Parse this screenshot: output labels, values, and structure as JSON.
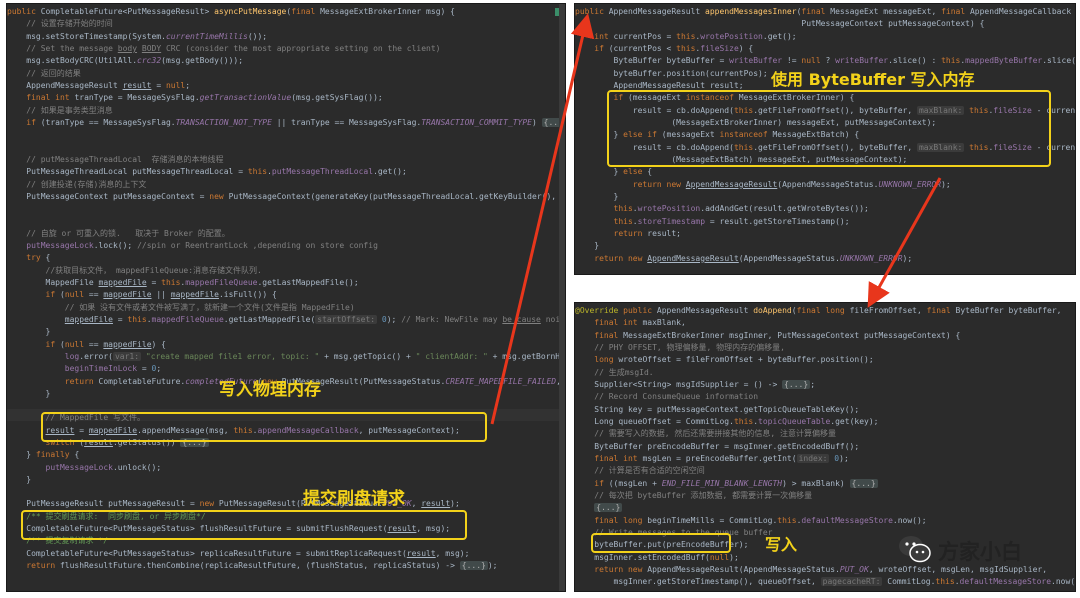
{
  "colors": {
    "highlight_box": "#f3d21a",
    "arrow": "#e8361c",
    "editor_bg": "#2b2b2b"
  },
  "left_panel": {
    "lines": [
      "public CompletableFuture<PutMessageResult> asyncPutMessage(final MessageExtBrokerInner msg) {",
      "    // 设置存储开始的时间",
      "    msg.setStoreTimestamp(System.currentTimeMillis());",
      "    // Set the message body BODY CRC (consider the most appropriate setting on the client)",
      "    msg.setBodyCRC(UtilAll.crc32(msg.getBody()));",
      "    // 返回的结果",
      "    AppendMessageResult result = null;",
      "    final int tranType = MessageSysFlag.getTransactionValue(msg.getSysFlag());",
      "    // 如果是事务类型消息",
      "    if (tranType == MessageSysFlag.TRANSACTION_NOT_TYPE || tranType == MessageSysFlag.TRANSACTION_COMMIT_TYPE) {...}",
      "",
      "    // putMessageThreadLocal  存储消息的本地线程",
      "    PutMessageThreadLocal putMessageThreadLocal = this.putMessageThreadLocal.get();",
      "    // 创建投递(存储)消息的上下文",
      "    PutMessageContext putMessageContext = new PutMessageContext(generateKey(putMessageThreadLocal.getKeyBuilder(), m",
      "",
      "    // 自旋 or 可重入的锁.   取决于 Broker 的配置。",
      "    putMessageLock.lock(); //spin or ReentrantLock ,depending on store config",
      "    try {",
      "        //获取目标文件， mappedFileQueue:消息存储文件队列.",
      "        MappedFile mappedFile = this.mappedFileQueue.getLastMappedFile();",
      "        if (null == mappedFile || mappedFile.isFull()) {",
      "            // 如果 没有文件或者文件被写满了，就新建一个文件(文件是指 MappedFile)",
      "            mappedFile = this.mappedFileQueue.getLastMappedFile( startOffset: 0); // Mark: NewFile may be cause noise",
      "        }",
      "        if (null == mappedFile) {",
      "            log.error( var1: \"create mapped file1 error, topic: \" + msg.getTopic() + \" clientAddr: \" + msg.getBornHost",
      "            beginTimeInLock = 0;",
      "            return CompletableFuture.completedFuture(new PutMessageResult(PutMessageStatus.CREATE_MAPEDFILE_FAILED,",
      "        }",
      "        // MappedFile 写文件。",
      "        result = mappedFile.appendMessage(msg, this.appendMessageCallback, putMessageContext);",
      "        switch (result.getStatus()) {...}",
      "    } finally {",
      "        putMessageLock.unlock();",
      "    }",
      "",
      "    PutMessageResult putMessageResult = new PutMessageResult(PutMessageStatus.PUT_OK, result);",
      "    /** 提交刷盘请求:  同步刷盘, or 异步刷盘*/",
      "    CompletableFuture<PutMessageStatus> flushResultFuture = submitFlushRequest(result, msg);",
      "    /** 提交复制请求 */",
      "    CompletableFuture<PutMessageStatus> replicaResultFuture = submitReplicaRequest(result, msg);",
      "    return flushResultFuture.thenCombine(replicaResultFuture, (flushStatus, replicaStatus) -> {...});"
    ],
    "label_write": "写入物理内存",
    "label_flush": "提交刷盘请求"
  },
  "top_right_panel": {
    "lines": [
      "public AppendMessageResult appendMessagesInner(final MessageExt messageExt, final AppendMessageCallback cb,",
      "                                               PutMessageContext putMessageContext) {",
      "    int currentPos = this.wrotePosition.get();",
      "    if (currentPos < this.fileSize) {",
      "        ByteBuffer byteBuffer = writeBuffer != null ? writeBuffer.slice() : this.mappedByteBuffer.slice();",
      "        byteBuffer.position(currentPos);",
      "        AppendMessageResult result;",
      "        if (messageExt instanceof MessageExtBrokerInner) {",
      "            result = cb.doAppend(this.getFileFromOffset(), byteBuffer,  maxBlank: this.fileSize - currentPos,",
      "                    (MessageExtBrokerInner) messageExt, putMessageContext);",
      "        } else if (messageExt instanceof MessageExtBatch) {",
      "            result = cb.doAppend(this.getFileFromOffset(), byteBuffer,  maxBlank: this.fileSize - currentPos,",
      "                    (MessageExtBatch) messageExt, putMessageContext);",
      "        } else {",
      "            return new AppendMessageResult(AppendMessageStatus.UNKNOWN_ERROR);",
      "        }",
      "        this.wrotePosition.addAndGet(result.getWroteBytes());",
      "        this.storeTimestamp = result.getStoreTimestamp();",
      "        return result;",
      "    }",
      "    return new AppendMessageResult(AppendMessageStatus.UNKNOWN_ERROR);"
    ],
    "label_bytebuffer": "使用 ByteBuffer 写入内存"
  },
  "bottom_right_panel": {
    "lines": [
      "@Override public AppendMessageResult doAppend(final long fileFromOffset, final ByteBuffer byteBuffer,",
      "    final int maxBlank,",
      "    final MessageExtBrokerInner msgInner, PutMessageContext putMessageContext) {",
      "    // PHY OFFSET, 物理偏移量, 物理内存的偏移量,",
      "    long wroteOffset = fileFromOffset + byteBuffer.position();",
      "    // 生成msgId.",
      "    Supplier<String> msgIdSupplier = () -> {...};",
      "    // Record ConsumeQueue information",
      "    String key = putMessageContext.getTopicQueueTableKey();",
      "    Long queueOffset = CommitLog.this.topicQueueTable.get(key);",
      "    // 需要写入的数据, 然后还需要拼接其他的信息, 注意计算偏移量",
      "    ByteBuffer preEncodeBuffer = msgInner.getEncodedBuff();",
      "    final int msgLen = preEncodeBuffer.getInt( index: 0);",
      "    // 计算是否有合适的空闲空间",
      "    if ((msgLen + END_FILE_MIN_BLANK_LENGTH) > maxBlank) {...}",
      "    // 每次把 byteBuffer 添加数据, 都需要计算一次偏移量",
      "    {...}",
      "    final long beginTimeMills = CommitLog.this.defaultMessageStore.now();",
      "    // Write messages to the queue buffer",
      "    byteBuffer.put(preEncodeBuffer);",
      "    msgInner.setEncodedBuff(null);",
      "    return new AppendMessageResult(AppendMessageStatus.PUT_OK, wroteOffset, msgLen, msgIdSupplier,",
      "        msgInner.getStoreTimestamp(), queueOffset,  pagecacheRT: CommitLog.this.defaultMessageStore.now() - beginTimeM"
    ],
    "label_write": "写入"
  },
  "watermark": {
    "icon": "wechat-icon",
    "text": "方家小白"
  }
}
